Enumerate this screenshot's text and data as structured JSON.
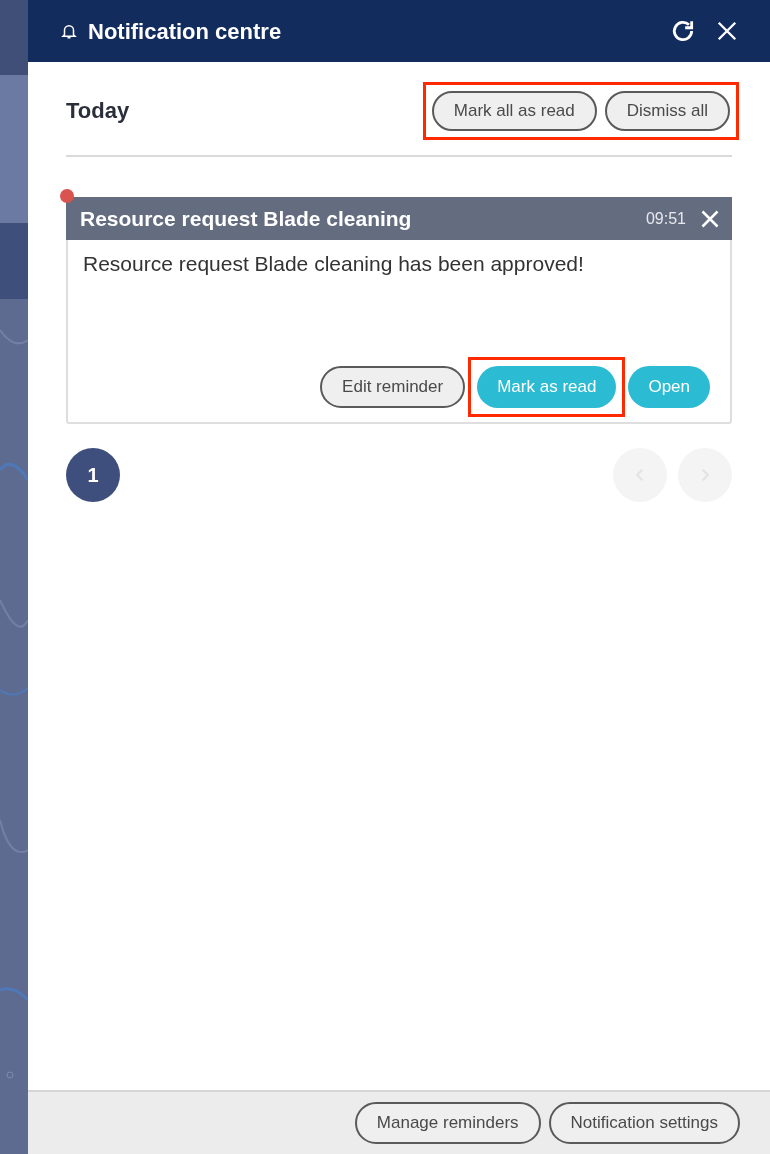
{
  "panel": {
    "title": "Notification centre"
  },
  "section": {
    "title": "Today",
    "highlighted": true,
    "actions": [
      "Mark all as read",
      "Dismiss all"
    ]
  },
  "notifications": [
    {
      "title": "Resource request Blade cleaning",
      "time": "09:51",
      "unread": true,
      "message": "Resource request Blade cleaning has been approved!",
      "buttons": [
        {
          "label": "Edit reminder",
          "kind": "outline",
          "highlighted": false
        },
        {
          "label": "Mark as read",
          "kind": "primary",
          "highlighted": true
        },
        {
          "label": "Open",
          "kind": "primary",
          "highlighted": false
        }
      ]
    }
  ],
  "pagination": {
    "pages": [
      {
        "label": "1",
        "selected": true
      }
    ],
    "prev_disabled": true,
    "next_disabled": true
  },
  "footer": {
    "buttons": [
      "Manage reminders",
      "Notification settings"
    ]
  }
}
